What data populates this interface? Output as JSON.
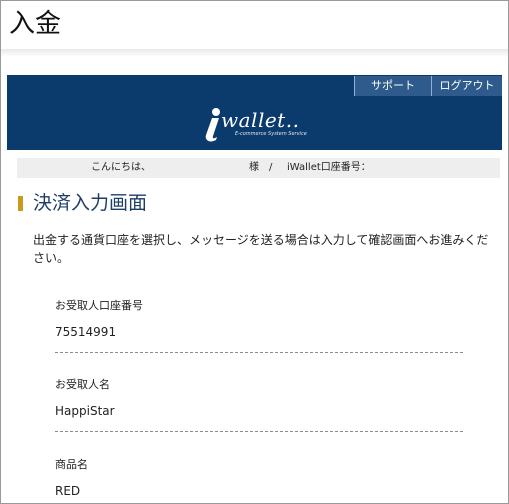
{
  "page": {
    "title": "入金"
  },
  "header": {
    "nav": {
      "support_label": "サポート",
      "logout_label": "ログアウト"
    },
    "logo": {
      "word": "wallet..",
      "tagline": "E-commerce System Service"
    },
    "colors": {
      "band": "#0b3a6c",
      "nav_button": "#2f5b8c",
      "marker": "#c99a1e"
    }
  },
  "greeting": {
    "hello": "こんにちは、",
    "sama": "様",
    "separator": "/",
    "account_label": "iWallet口座番号："
  },
  "section": {
    "title": "決済入力画面",
    "instruction": "出金する通貨口座を選択し、メッセージを送る場合は入力して確認画面へお進みください。"
  },
  "fields": [
    {
      "label": "お受取人口座番号",
      "value": "75514991"
    },
    {
      "label": "お受取人名",
      "value": "HappiStar"
    },
    {
      "label": "商品名",
      "value": "RED"
    }
  ]
}
